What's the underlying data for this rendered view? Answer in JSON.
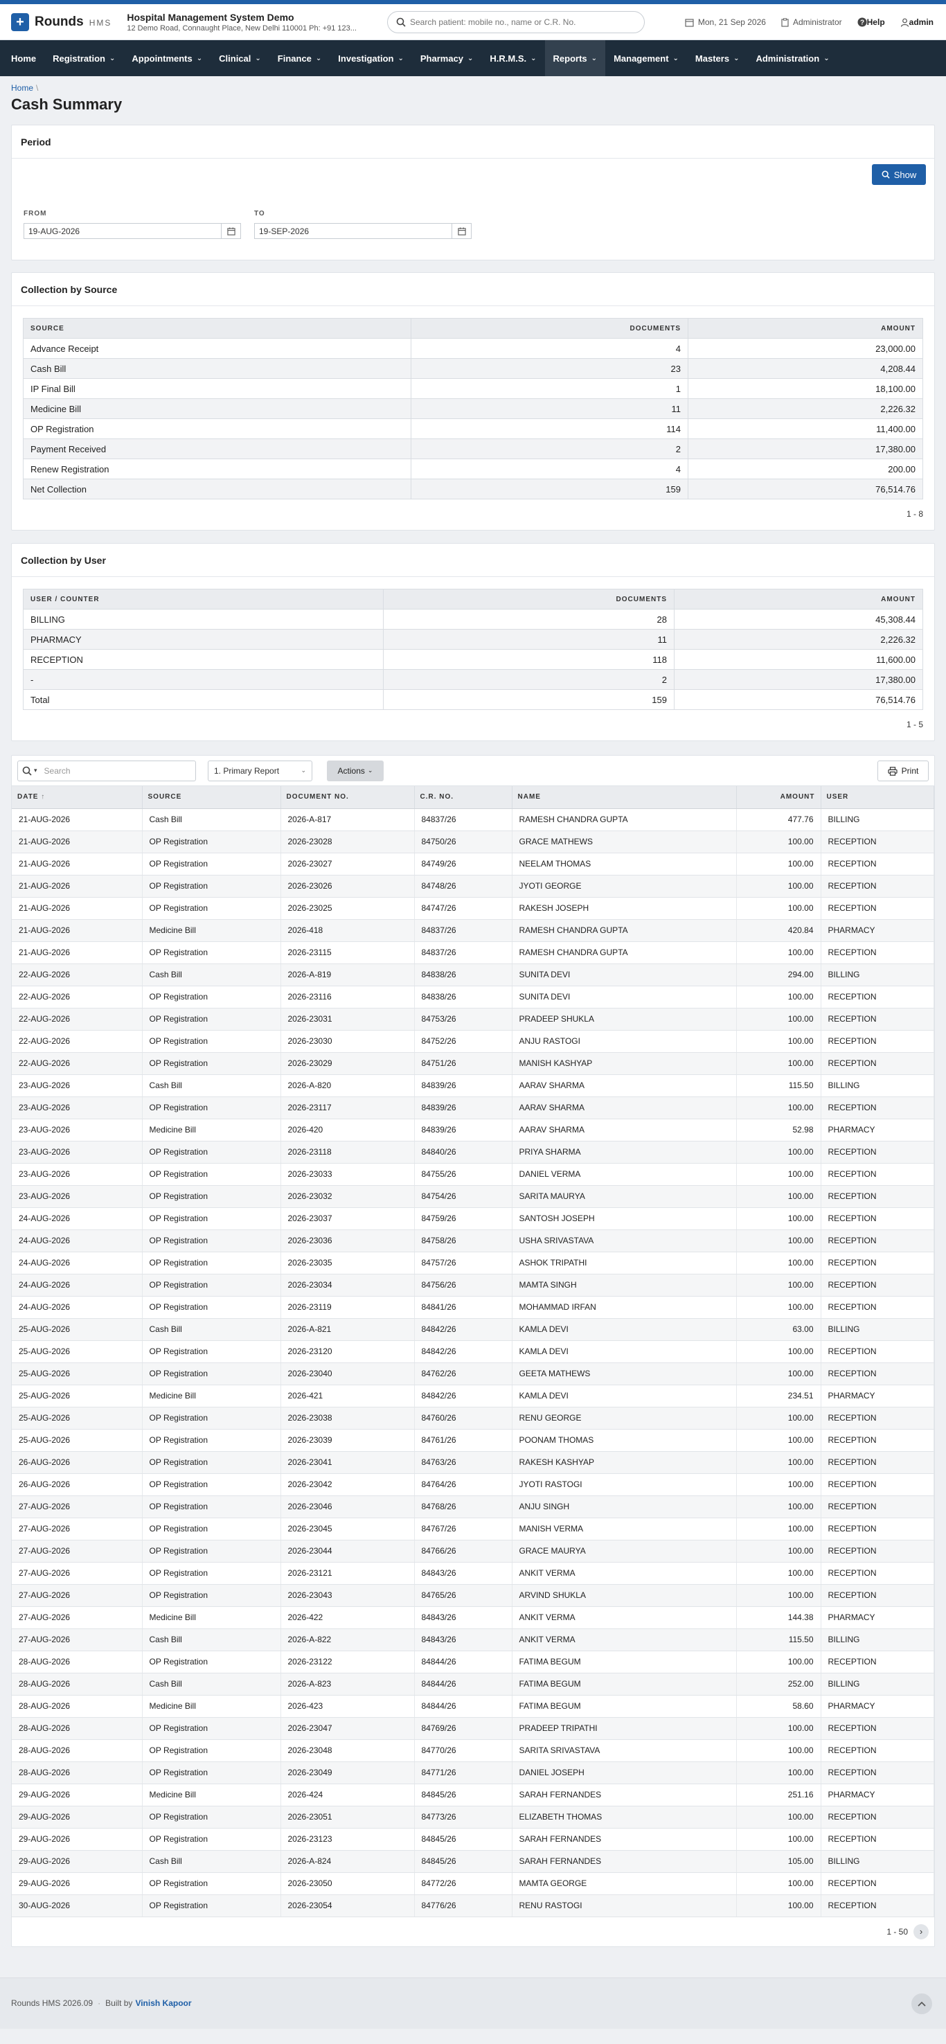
{
  "app": {
    "name": "Rounds",
    "sub": "HMS",
    "hospital": "Hospital Management System Demo",
    "address": "12 Demo Road, Connaught Place, New Delhi 110001 Ph: +91 123..."
  },
  "search": {
    "placeholder": "Search patient: mobile no., name or C.R. No."
  },
  "header": {
    "date": "Mon, 21 Sep 2026",
    "role": "Administrator",
    "help": "Help",
    "user": "admin"
  },
  "nav": [
    "Home",
    "Registration",
    "Appointments",
    "Clinical",
    "Finance",
    "Investigation",
    "Pharmacy",
    "H.R.M.S.",
    "Reports",
    "Management",
    "Masters",
    "Administration"
  ],
  "breadcrumb": {
    "home": "Home",
    "sep": "\\"
  },
  "page_title": "Cash Summary",
  "period": {
    "title": "Period",
    "show": "Show",
    "from_label": "FROM",
    "to_label": "TO",
    "from": "19-AUG-2026",
    "to": "19-SEP-2026"
  },
  "by_source": {
    "title": "Collection by Source",
    "headers": [
      "SOURCE",
      "DOCUMENTS",
      "AMOUNT"
    ],
    "rows": [
      [
        "Advance Receipt",
        "4",
        "23,000.00"
      ],
      [
        "Cash Bill",
        "23",
        "4,208.44"
      ],
      [
        "IP Final Bill",
        "1",
        "18,100.00"
      ],
      [
        "Medicine Bill",
        "11",
        "2,226.32"
      ],
      [
        "OP Registration",
        "114",
        "11,400.00"
      ],
      [
        "Payment Received",
        "2",
        "17,380.00"
      ],
      [
        "Renew Registration",
        "4",
        "200.00"
      ],
      [
        "Net Collection",
        "159",
        "76,514.76"
      ]
    ],
    "pager": "1 - 8"
  },
  "by_user": {
    "title": "Collection by User",
    "headers": [
      "USER / COUNTER",
      "DOCUMENTS",
      "AMOUNT"
    ],
    "rows": [
      [
        "BILLING",
        "28",
        "45,308.44"
      ],
      [
        "PHARMACY",
        "11",
        "2,226.32"
      ],
      [
        "RECEPTION",
        "118",
        "11,600.00"
      ],
      [
        "-",
        "2",
        "17,380.00"
      ],
      [
        "Total",
        "159",
        "76,514.76"
      ]
    ],
    "pager": "1 - 5"
  },
  "list": {
    "search_placeholder": "Search",
    "report_select": "1. Primary Report",
    "actions": "Actions",
    "print": "Print",
    "headers": [
      "DATE",
      "SOURCE",
      "DOCUMENT NO.",
      "C.R. NO.",
      "NAME",
      "AMOUNT",
      "USER"
    ],
    "sort_icon": "↑",
    "rows": [
      [
        "21-AUG-2026",
        "Cash Bill",
        "2026-A-817",
        "84837/26",
        "RAMESH CHANDRA GUPTA",
        "477.76",
        "BILLING"
      ],
      [
        "21-AUG-2026",
        "OP Registration",
        "2026-23028",
        "84750/26",
        "GRACE MATHEWS",
        "100.00",
        "RECEPTION"
      ],
      [
        "21-AUG-2026",
        "OP Registration",
        "2026-23027",
        "84749/26",
        "NEELAM THOMAS",
        "100.00",
        "RECEPTION"
      ],
      [
        "21-AUG-2026",
        "OP Registration",
        "2026-23026",
        "84748/26",
        "JYOTI GEORGE",
        "100.00",
        "RECEPTION"
      ],
      [
        "21-AUG-2026",
        "OP Registration",
        "2026-23025",
        "84747/26",
        "RAKESH JOSEPH",
        "100.00",
        "RECEPTION"
      ],
      [
        "21-AUG-2026",
        "Medicine Bill",
        "2026-418",
        "84837/26",
        "RAMESH CHANDRA GUPTA",
        "420.84",
        "PHARMACY"
      ],
      [
        "21-AUG-2026",
        "OP Registration",
        "2026-23115",
        "84837/26",
        "RAMESH CHANDRA GUPTA",
        "100.00",
        "RECEPTION"
      ],
      [
        "22-AUG-2026",
        "Cash Bill",
        "2026-A-819",
        "84838/26",
        "SUNITA DEVI",
        "294.00",
        "BILLING"
      ],
      [
        "22-AUG-2026",
        "OP Registration",
        "2026-23116",
        "84838/26",
        "SUNITA DEVI",
        "100.00",
        "RECEPTION"
      ],
      [
        "22-AUG-2026",
        "OP Registration",
        "2026-23031",
        "84753/26",
        "PRADEEP SHUKLA",
        "100.00",
        "RECEPTION"
      ],
      [
        "22-AUG-2026",
        "OP Registration",
        "2026-23030",
        "84752/26",
        "ANJU RASTOGI",
        "100.00",
        "RECEPTION"
      ],
      [
        "22-AUG-2026",
        "OP Registration",
        "2026-23029",
        "84751/26",
        "MANISH KASHYAP",
        "100.00",
        "RECEPTION"
      ],
      [
        "23-AUG-2026",
        "Cash Bill",
        "2026-A-820",
        "84839/26",
        "AARAV SHARMA",
        "115.50",
        "BILLING"
      ],
      [
        "23-AUG-2026",
        "OP Registration",
        "2026-23117",
        "84839/26",
        "AARAV SHARMA",
        "100.00",
        "RECEPTION"
      ],
      [
        "23-AUG-2026",
        "Medicine Bill",
        "2026-420",
        "84839/26",
        "AARAV SHARMA",
        "52.98",
        "PHARMACY"
      ],
      [
        "23-AUG-2026",
        "OP Registration",
        "2026-23118",
        "84840/26",
        "PRIYA SHARMA",
        "100.00",
        "RECEPTION"
      ],
      [
        "23-AUG-2026",
        "OP Registration",
        "2026-23033",
        "84755/26",
        "DANIEL VERMA",
        "100.00",
        "RECEPTION"
      ],
      [
        "23-AUG-2026",
        "OP Registration",
        "2026-23032",
        "84754/26",
        "SARITA MAURYA",
        "100.00",
        "RECEPTION"
      ],
      [
        "24-AUG-2026",
        "OP Registration",
        "2026-23037",
        "84759/26",
        "SANTOSH JOSEPH",
        "100.00",
        "RECEPTION"
      ],
      [
        "24-AUG-2026",
        "OP Registration",
        "2026-23036",
        "84758/26",
        "USHA SRIVASTAVA",
        "100.00",
        "RECEPTION"
      ],
      [
        "24-AUG-2026",
        "OP Registration",
        "2026-23035",
        "84757/26",
        "ASHOK TRIPATHI",
        "100.00",
        "RECEPTION"
      ],
      [
        "24-AUG-2026",
        "OP Registration",
        "2026-23034",
        "84756/26",
        "MAMTA SINGH",
        "100.00",
        "RECEPTION"
      ],
      [
        "24-AUG-2026",
        "OP Registration",
        "2026-23119",
        "84841/26",
        "MOHAMMAD IRFAN",
        "100.00",
        "RECEPTION"
      ],
      [
        "25-AUG-2026",
        "Cash Bill",
        "2026-A-821",
        "84842/26",
        "KAMLA DEVI",
        "63.00",
        "BILLING"
      ],
      [
        "25-AUG-2026",
        "OP Registration",
        "2026-23120",
        "84842/26",
        "KAMLA DEVI",
        "100.00",
        "RECEPTION"
      ],
      [
        "25-AUG-2026",
        "OP Registration",
        "2026-23040",
        "84762/26",
        "GEETA MATHEWS",
        "100.00",
        "RECEPTION"
      ],
      [
        "25-AUG-2026",
        "Medicine Bill",
        "2026-421",
        "84842/26",
        "KAMLA DEVI",
        "234.51",
        "PHARMACY"
      ],
      [
        "25-AUG-2026",
        "OP Registration",
        "2026-23038",
        "84760/26",
        "RENU GEORGE",
        "100.00",
        "RECEPTION"
      ],
      [
        "25-AUG-2026",
        "OP Registration",
        "2026-23039",
        "84761/26",
        "POONAM THOMAS",
        "100.00",
        "RECEPTION"
      ],
      [
        "26-AUG-2026",
        "OP Registration",
        "2026-23041",
        "84763/26",
        "RAKESH KASHYAP",
        "100.00",
        "RECEPTION"
      ],
      [
        "26-AUG-2026",
        "OP Registration",
        "2026-23042",
        "84764/26",
        "JYOTI RASTOGI",
        "100.00",
        "RECEPTION"
      ],
      [
        "27-AUG-2026",
        "OP Registration",
        "2026-23046",
        "84768/26",
        "ANJU SINGH",
        "100.00",
        "RECEPTION"
      ],
      [
        "27-AUG-2026",
        "OP Registration",
        "2026-23045",
        "84767/26",
        "MANISH VERMA",
        "100.00",
        "RECEPTION"
      ],
      [
        "27-AUG-2026",
        "OP Registration",
        "2026-23044",
        "84766/26",
        "GRACE MAURYA",
        "100.00",
        "RECEPTION"
      ],
      [
        "27-AUG-2026",
        "OP Registration",
        "2026-23121",
        "84843/26",
        "ANKIT VERMA",
        "100.00",
        "RECEPTION"
      ],
      [
        "27-AUG-2026",
        "OP Registration",
        "2026-23043",
        "84765/26",
        "ARVIND SHUKLA",
        "100.00",
        "RECEPTION"
      ],
      [
        "27-AUG-2026",
        "Medicine Bill",
        "2026-422",
        "84843/26",
        "ANKIT VERMA",
        "144.38",
        "PHARMACY"
      ],
      [
        "27-AUG-2026",
        "Cash Bill",
        "2026-A-822",
        "84843/26",
        "ANKIT VERMA",
        "115.50",
        "BILLING"
      ],
      [
        "28-AUG-2026",
        "OP Registration",
        "2026-23122",
        "84844/26",
        "FATIMA BEGUM",
        "100.00",
        "RECEPTION"
      ],
      [
        "28-AUG-2026",
        "Cash Bill",
        "2026-A-823",
        "84844/26",
        "FATIMA BEGUM",
        "252.00",
        "BILLING"
      ],
      [
        "28-AUG-2026",
        "Medicine Bill",
        "2026-423",
        "84844/26",
        "FATIMA BEGUM",
        "58.60",
        "PHARMACY"
      ],
      [
        "28-AUG-2026",
        "OP Registration",
        "2026-23047",
        "84769/26",
        "PRADEEP TRIPATHI",
        "100.00",
        "RECEPTION"
      ],
      [
        "28-AUG-2026",
        "OP Registration",
        "2026-23048",
        "84770/26",
        "SARITA SRIVASTAVA",
        "100.00",
        "RECEPTION"
      ],
      [
        "28-AUG-2026",
        "OP Registration",
        "2026-23049",
        "84771/26",
        "DANIEL JOSEPH",
        "100.00",
        "RECEPTION"
      ],
      [
        "29-AUG-2026",
        "Medicine Bill",
        "2026-424",
        "84845/26",
        "SARAH FERNANDES",
        "251.16",
        "PHARMACY"
      ],
      [
        "29-AUG-2026",
        "OP Registration",
        "2026-23051",
        "84773/26",
        "ELIZABETH THOMAS",
        "100.00",
        "RECEPTION"
      ],
      [
        "29-AUG-2026",
        "OP Registration",
        "2026-23123",
        "84845/26",
        "SARAH FERNANDES",
        "100.00",
        "RECEPTION"
      ],
      [
        "29-AUG-2026",
        "Cash Bill",
        "2026-A-824",
        "84845/26",
        "SARAH FERNANDES",
        "105.00",
        "BILLING"
      ],
      [
        "29-AUG-2026",
        "OP Registration",
        "2026-23050",
        "84772/26",
        "MAMTA GEORGE",
        "100.00",
        "RECEPTION"
      ],
      [
        "30-AUG-2026",
        "OP Registration",
        "2026-23054",
        "84776/26",
        "RENU RASTOGI",
        "100.00",
        "RECEPTION"
      ]
    ],
    "pager": "1 - 50"
  },
  "footer": {
    "version": "Rounds HMS 2026.09",
    "built_by_label": "Built by",
    "author": "Vinish Kapoor"
  },
  "colors": {
    "brand": "#1f5fa7",
    "nav_bg": "#1e2d3b",
    "nav_active": "#33414f"
  }
}
